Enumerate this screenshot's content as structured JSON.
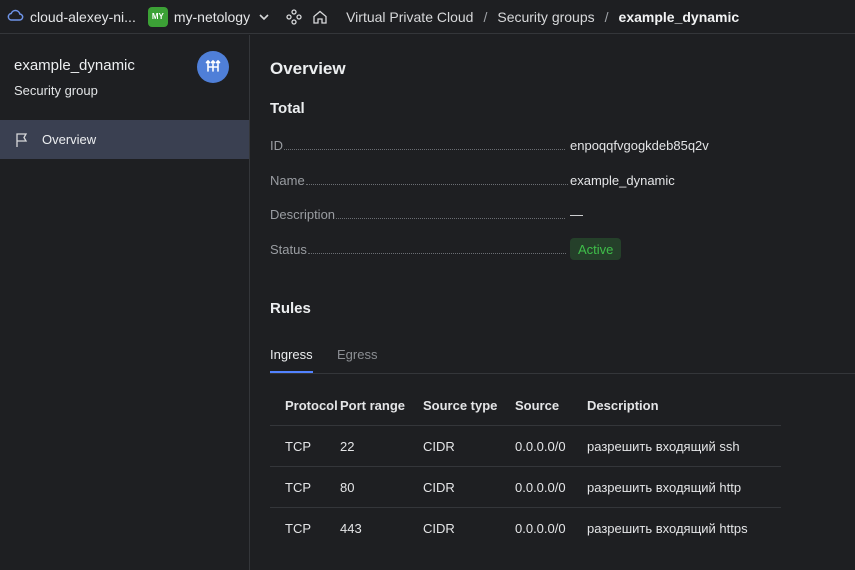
{
  "header": {
    "cloud_name": "cloud-alexey-ni...",
    "folder_badge": "MY",
    "folder_name": "my-netology",
    "breadcrumbs": [
      "Virtual Private Cloud",
      "Security groups",
      "example_dynamic"
    ]
  },
  "sidebar": {
    "title": "example_dynamic",
    "subtitle": "Security group",
    "items": [
      {
        "label": "Overview",
        "icon": "flag-icon",
        "selected": true
      }
    ]
  },
  "main": {
    "title": "Overview",
    "total_heading": "Total",
    "fields": [
      {
        "key": "ID",
        "value": "enpoqqfvgogkdeb85q2v"
      },
      {
        "key": "Name",
        "value": "example_dynamic"
      },
      {
        "key": "Description",
        "value": "—"
      },
      {
        "key": "Status",
        "value": "Active"
      }
    ],
    "rules_heading": "Rules",
    "tabs": [
      {
        "label": "Ingress",
        "active": true
      },
      {
        "label": "Egress",
        "active": false
      }
    ],
    "table": {
      "headers": [
        "Protocol",
        "Port range",
        "Source type",
        "Source",
        "Description"
      ],
      "rows": [
        [
          "TCP",
          "22",
          "CIDR",
          "0.0.0.0/0",
          "разрешить входящий ssh"
        ],
        [
          "TCP",
          "80",
          "CIDR",
          "0.0.0.0/0",
          "разрешить входящий http"
        ],
        [
          "TCP",
          "443",
          "CIDR",
          "0.0.0.0/0",
          "разрешить входящий https"
        ]
      ]
    }
  },
  "colors": {
    "accent": "#5282ff",
    "status_active": "#3fbf4a",
    "folder_badge": "#3ca136",
    "selected_item": "#3a4051"
  }
}
